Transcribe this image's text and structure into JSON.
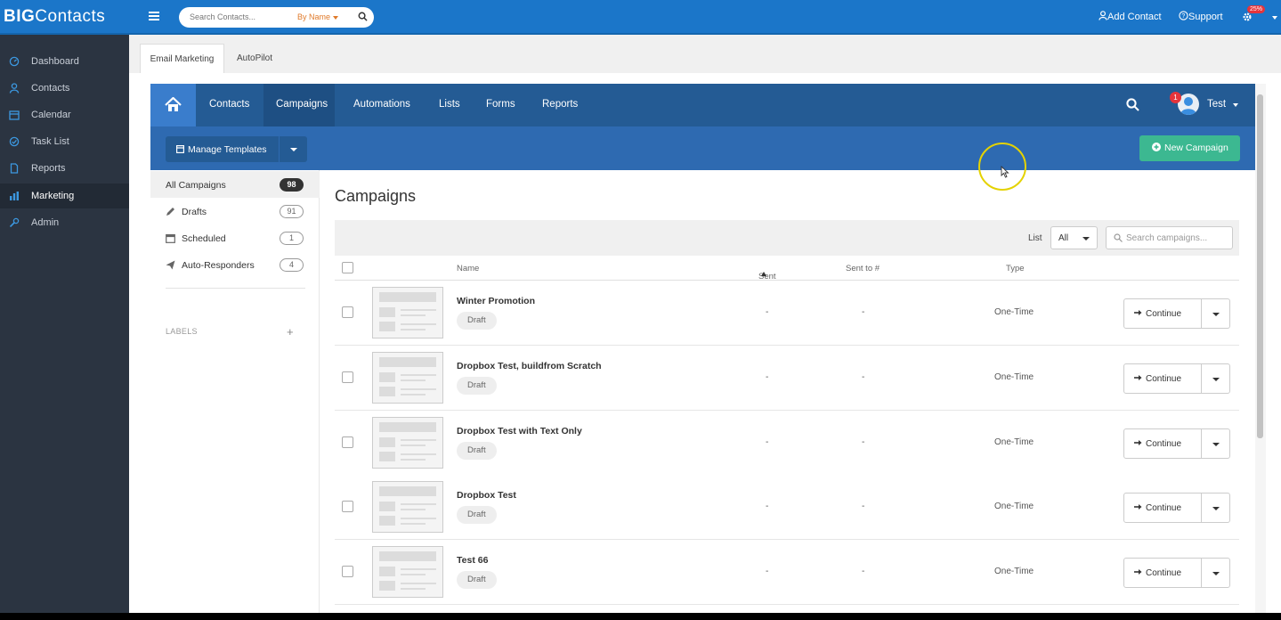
{
  "topbar": {
    "logo_bold": "BIG",
    "logo_light": "Contacts",
    "search_placeholder": "Search Contacts...",
    "search_mode": "By Name",
    "add_contact": "Add Contact",
    "support": "Support",
    "progress_badge": "25%"
  },
  "sidebar": {
    "items": [
      {
        "label": "Dashboard"
      },
      {
        "label": "Contacts"
      },
      {
        "label": "Calendar"
      },
      {
        "label": "Task List"
      },
      {
        "label": "Reports"
      },
      {
        "label": "Marketing"
      },
      {
        "label": "Admin"
      }
    ]
  },
  "page_tabs": [
    "Email Marketing",
    "AutoPilot"
  ],
  "nav": {
    "items": [
      "Contacts",
      "Campaigns",
      "Automations",
      "Lists",
      "Forms",
      "Reports"
    ],
    "notif_count": "1",
    "user": "Test"
  },
  "toolbar": {
    "manage_templates": "Manage Templates",
    "new_campaign": "New Campaign"
  },
  "filters": [
    {
      "label": "All Campaigns",
      "count": "98"
    },
    {
      "label": "Drafts",
      "count": "91"
    },
    {
      "label": "Scheduled",
      "count": "1"
    },
    {
      "label": "Auto-Responders",
      "count": "4"
    }
  ],
  "labels_heading": "LABELS",
  "main": {
    "title": "Campaigns",
    "list_label": "List",
    "list_value": "All",
    "search_placeholder": "Search campaigns...",
    "columns": {
      "name": "Name",
      "sent": "Sent",
      "sent_to": "Sent to #",
      "type": "Type"
    },
    "rows": [
      {
        "name": "Winter Promotion",
        "status": "Draft",
        "sent": "-",
        "sent_to": "-",
        "type": "One-Time",
        "action": "Continue"
      },
      {
        "name": "Dropbox Test, buildfrom Scratch",
        "status": "Draft",
        "sent": "-",
        "sent_to": "-",
        "type": "One-Time",
        "action": "Continue"
      },
      {
        "name": "Dropbox Test with Text Only",
        "status": "Draft",
        "sent": "-",
        "sent_to": "-",
        "type": "One-Time",
        "action": "Continue"
      },
      {
        "name": "Dropbox Test",
        "status": "Draft",
        "sent": "-",
        "sent_to": "-",
        "type": "One-Time",
        "action": "Continue"
      },
      {
        "name": "Test 66",
        "status": "Draft",
        "sent": "-",
        "sent_to": "-",
        "type": "One-Time",
        "action": "Continue"
      }
    ]
  },
  "colors": {
    "topbar": "#1b76c9",
    "sidebar": "#2b3441",
    "nav": "#245b94",
    "toolbar": "#2e6ab1",
    "new_campaign": "#3cb891"
  }
}
